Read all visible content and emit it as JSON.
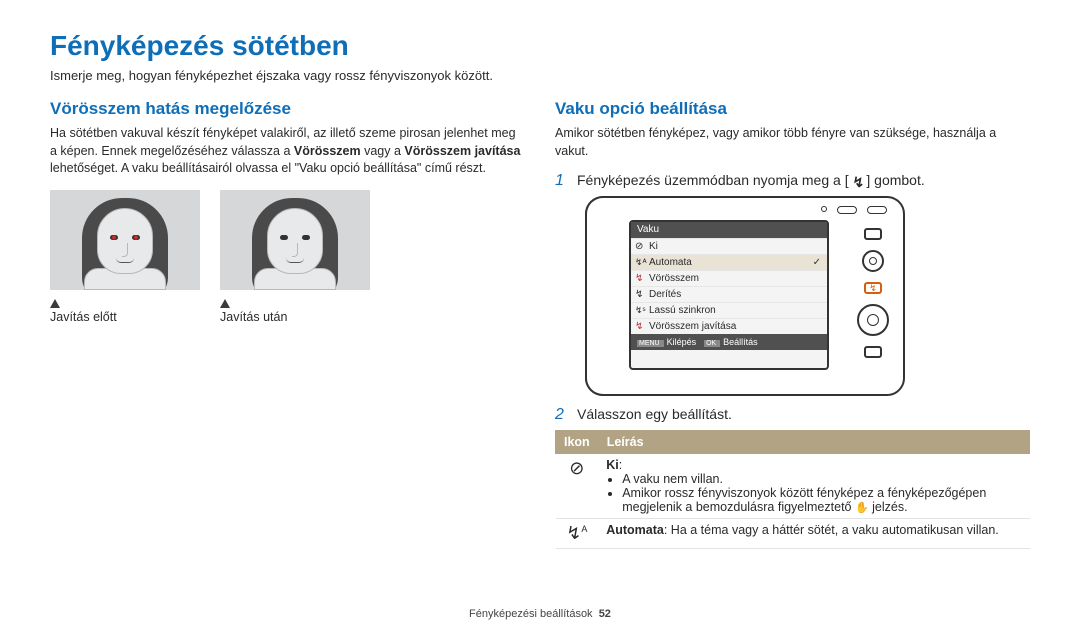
{
  "title": "Fényképezés sötétben",
  "intro": "Ismerje meg, hogyan fényképezhet éjszaka vagy rossz fényviszonyok között.",
  "left": {
    "heading": "Vörösszem hatás megelőzése",
    "para_pre": "Ha sötétben vakuval készít fényképet valakiről, az illető szeme pirosan jelenhet meg a képen. Ennek megelőzéséhez válassza a ",
    "bold1": "Vörösszem",
    "para_mid": " vagy a ",
    "bold2": "Vörösszem javítása",
    "para_post": " lehetőséget. A vaku beállításairól olvassa el \"Vaku opció beállítása\" című részt.",
    "cap_before": "Javítás előtt",
    "cap_after": "Javítás után"
  },
  "right": {
    "heading": "Vaku opció beállítása",
    "para": "Amikor sötétben fényképez, vagy amikor több fényre van szüksége, használja a vakut.",
    "step1_pre": "Fényképezés üzemmódban nyomja meg a [",
    "step1_post": "] gombot.",
    "step2": "Válasszon egy beállítást.",
    "menu": {
      "title": "Vaku",
      "items": [
        "Ki",
        "Automata",
        "Vörösszem",
        "Derítés",
        "Lassú szinkron",
        "Vörösszem javítása"
      ],
      "foot_exit": "Kilépés",
      "foot_set": "Beállítás"
    },
    "table": {
      "head_icon": "Ikon",
      "head_desc": "Leírás",
      "row1_title": "Ki",
      "row1_b1": "A vaku nem villan.",
      "row1_b2_pre": "Amikor rossz fényviszonyok között fényképez a fényképezőgépen megjelenik a bemozdulásra figyelmeztető ",
      "row1_b2_post": " jelzés.",
      "row2_title": "Automata",
      "row2_body": ": Ha a téma vagy a háttér sötét, a vaku automatikusan villan."
    }
  },
  "footer": {
    "section": "Fényképezési beállítások",
    "page": "52"
  }
}
